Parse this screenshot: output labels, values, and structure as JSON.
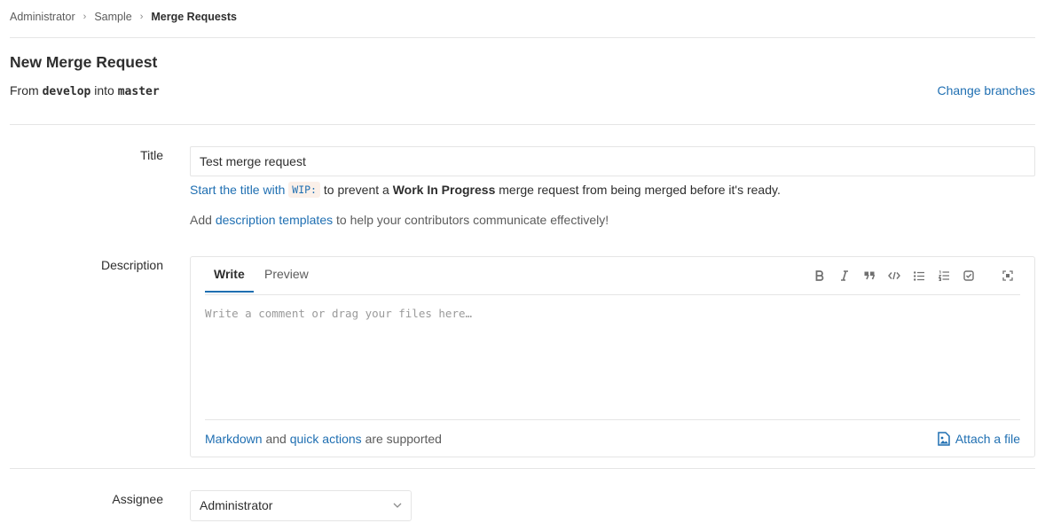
{
  "breadcrumb": {
    "items": [
      "Administrator",
      "Sample"
    ],
    "current": "Merge Requests",
    "separator": "›"
  },
  "header": {
    "title": "New Merge Request",
    "from_prefix": "From",
    "source_branch": "develop",
    "into_word": "into",
    "target_branch": "master",
    "change_branches": "Change branches"
  },
  "form": {
    "title_label": "Title",
    "title_value": "Test merge request",
    "wip_hint": {
      "link_text": "Start the title with",
      "code": "WIP:",
      "middle": "to prevent a",
      "bold": "Work In Progress",
      "end": "merge request from being merged before it's ready."
    },
    "templates_hint": {
      "prefix": "Add",
      "link": "description templates",
      "suffix": "to help your contributors communicate effectively!"
    },
    "description_label": "Description",
    "tabs": {
      "write": "Write",
      "preview": "Preview"
    },
    "toolbar_icons": [
      "bold-icon",
      "italic-icon",
      "quote-icon",
      "code-icon",
      "bullet-list-icon",
      "numbered-list-icon",
      "task-list-icon",
      "fullscreen-icon"
    ],
    "placeholder": "Write a comment or drag your files here…",
    "footer": {
      "markdown_link": "Markdown",
      "and_word": "and",
      "quick_actions_link": "quick actions",
      "supported_text": "are supported",
      "attach_file": "Attach a file"
    },
    "assignee_label": "Assignee",
    "assignee_value": "Administrator"
  },
  "colors": {
    "link": "#1f6fb2",
    "border": "#e5e5e5",
    "text": "#2e2e2e"
  }
}
